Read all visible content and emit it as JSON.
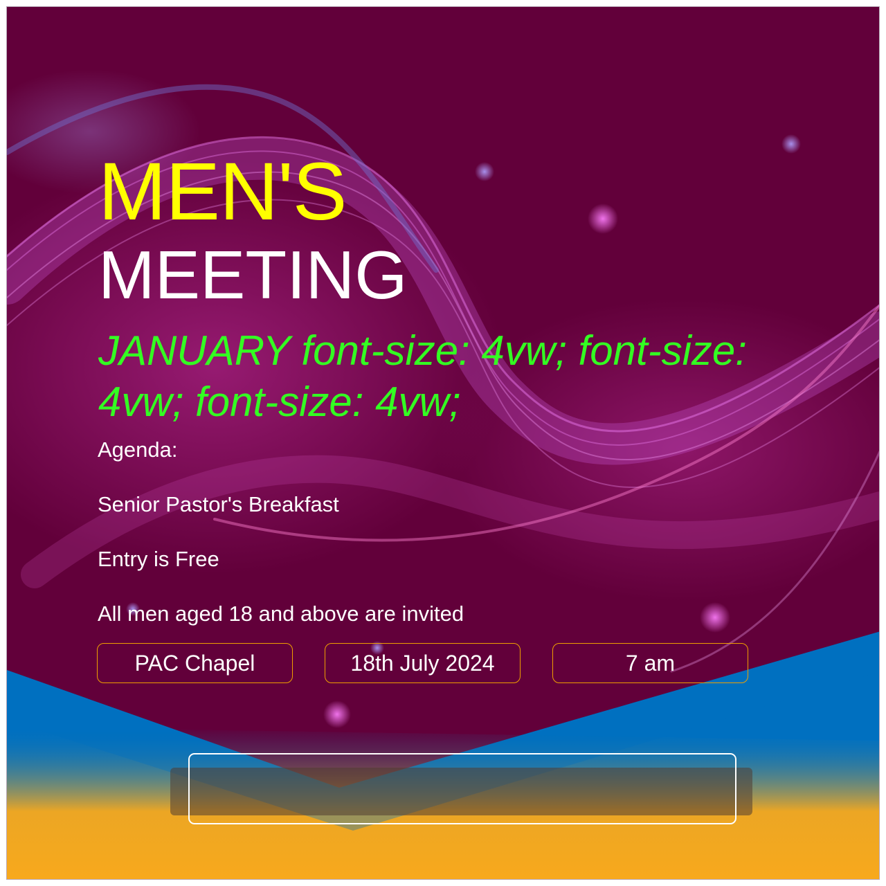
{
  "poster": {
    "title_top": "MEN'S",
    "title_bottom": "MEETING",
    "month": "JANUARY font-size: 4vw; font-size: 4vw; font-size: 4vw;",
    "agenda": [
      "Agenda:",
      "Senior Pastor's Breakfast",
      "Entry is Free",
      "All men aged 18 and above are invited"
    ],
    "details": {
      "venue": "PAC Chapel",
      "date": "18th July 2024",
      "time": "7 am"
    },
    "cta_label": ""
  },
  "colors": {
    "background": "#62003a",
    "title_top": "#ffff00",
    "title_bottom": "#ffffff",
    "month": "#33ff22",
    "pill_border": "#f0a000",
    "band_blue": "#0070c0",
    "band_orange": "#f8a91c"
  }
}
